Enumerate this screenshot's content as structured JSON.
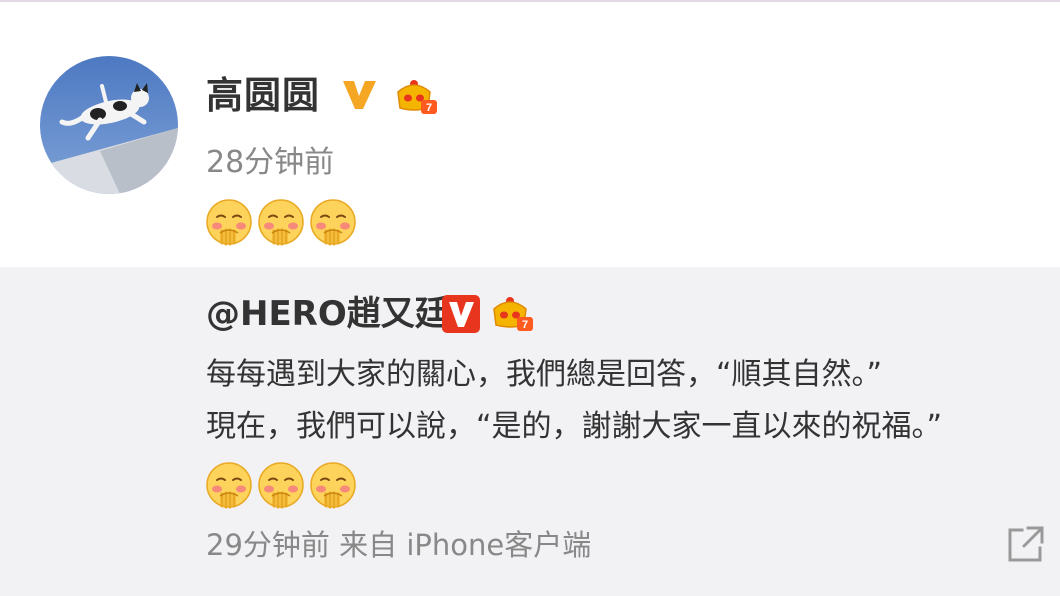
{
  "post": {
    "author": "高圆圆",
    "time": "28分钟前",
    "emojis": [
      "shy-emoji",
      "shy-emoji",
      "shy-emoji"
    ]
  },
  "repost": {
    "author": "@HERO趙又廷",
    "lines": [
      "每每遇到大家的關心，我們總是回答，“順其自然。”",
      "現在，我們可以說，“是的，謝謝大家一直以來的祝福。”"
    ],
    "emojis": [
      "shy-emoji",
      "shy-emoji",
      "shy-emoji"
    ],
    "time": "29分钟前",
    "source_prefix": "来自",
    "source": "iPhone客户端"
  },
  "colors": {
    "v_badge_gold": "#f5a623",
    "v_badge_red": "#e8351d",
    "vip_crown": "#f5b400",
    "repost_bg": "#f2f2f5",
    "meta_text": "#888888"
  }
}
